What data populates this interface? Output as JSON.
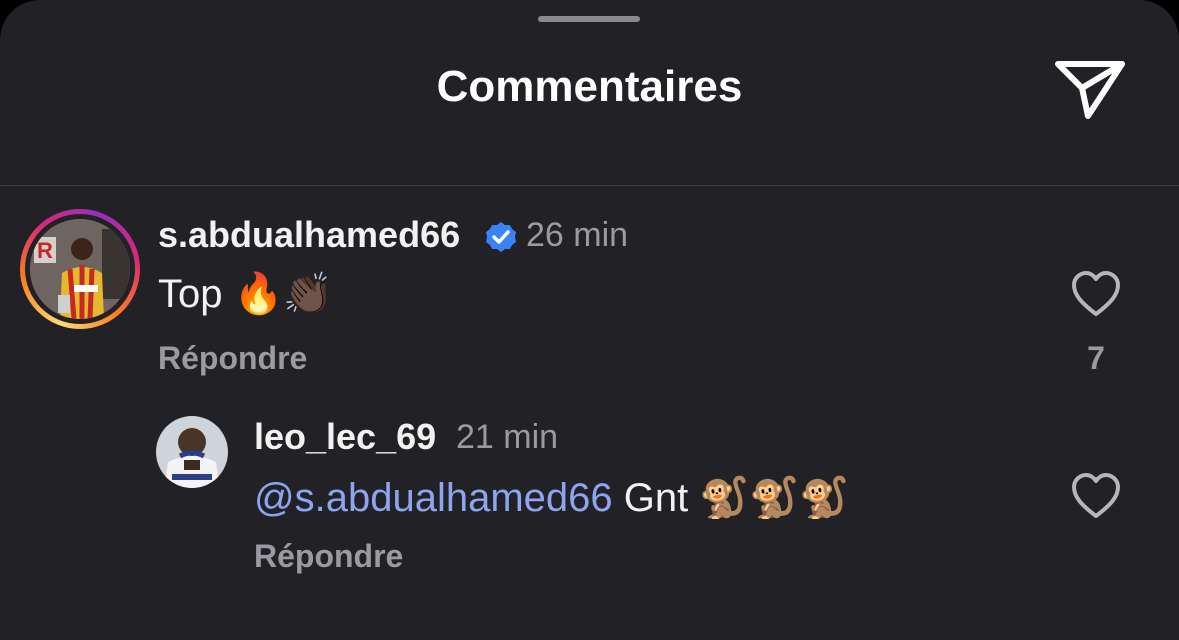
{
  "sheet": {
    "title": "Commentaires",
    "send_icon": "paper-plane-icon"
  },
  "comments": [
    {
      "username": "s.abdualhamed66",
      "verified": true,
      "verified_color": "#3b82f6",
      "time": "26 min",
      "text": "Top 🔥👏🏿",
      "reply_label": "Répondre",
      "like_count": "7",
      "has_story_ring": true
    },
    {
      "username": "leo_lec_69",
      "time": "21 min",
      "mention": "@s.abdualhamed66",
      "text": "Gnt 🐒🐒🐒",
      "reply_label": "Répondre"
    }
  ],
  "colors": {
    "background": "#222226",
    "mention": "#8da4f0",
    "muted": "#9a9aa0"
  }
}
